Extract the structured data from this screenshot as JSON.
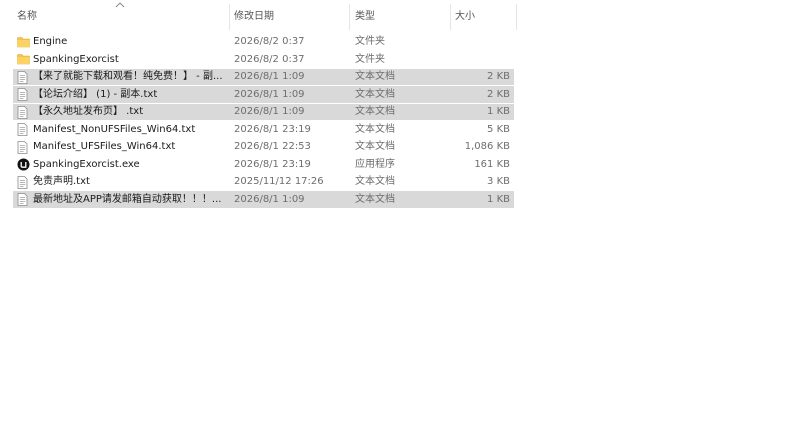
{
  "columns": {
    "name": "名称",
    "date": "修改日期",
    "type": "类型",
    "size": "大小"
  },
  "files": [
    {
      "name": "Engine",
      "date": "2026/8/2 0:37",
      "type": "文件夹",
      "size": "",
      "icon": "folder-icon",
      "selected": false
    },
    {
      "name": "SpankingExorcist",
      "date": "2026/8/2 0:37",
      "type": "文件夹",
      "size": "",
      "icon": "folder-icon",
      "selected": false
    },
    {
      "name": "【来了就能下载和观看！纯免费！】 - 副...",
      "date": "2026/8/1 1:09",
      "type": "文本文档",
      "size": "2 KB",
      "icon": "text-file-icon",
      "selected": true
    },
    {
      "name": "【论坛介绍】 (1) - 副本.txt",
      "date": "2026/8/1 1:09",
      "type": "文本文档",
      "size": "2 KB",
      "icon": "text-file-icon",
      "selected": true
    },
    {
      "name": "【永久地址发布页】 .txt",
      "date": "2026/8/1 1:09",
      "type": "文本文档",
      "size": "1 KB",
      "icon": "text-file-icon",
      "selected": true
    },
    {
      "name": "Manifest_NonUFSFiles_Win64.txt",
      "date": "2026/8/1 23:19",
      "type": "文本文档",
      "size": "5 KB",
      "icon": "text-file-icon",
      "selected": false
    },
    {
      "name": "Manifest_UFSFiles_Win64.txt",
      "date": "2026/8/1 22:53",
      "type": "文本文档",
      "size": "1,086 KB",
      "icon": "text-file-icon",
      "selected": false
    },
    {
      "name": "SpankingExorcist.exe",
      "date": "2026/8/1 23:19",
      "type": "应用程序",
      "size": "161 KB",
      "icon": "unreal-engine-icon",
      "selected": false
    },
    {
      "name": "免责声明.txt",
      "date": "2025/11/12 17:26",
      "type": "文本文档",
      "size": "3 KB",
      "icon": "text-file-icon",
      "selected": false
    },
    {
      "name": "最新地址及APP请发邮箱自动获取！！！...",
      "date": "2026/8/1 1:09",
      "type": "文本文档",
      "size": "1 KB",
      "icon": "text-file-icon",
      "selected": true
    }
  ]
}
